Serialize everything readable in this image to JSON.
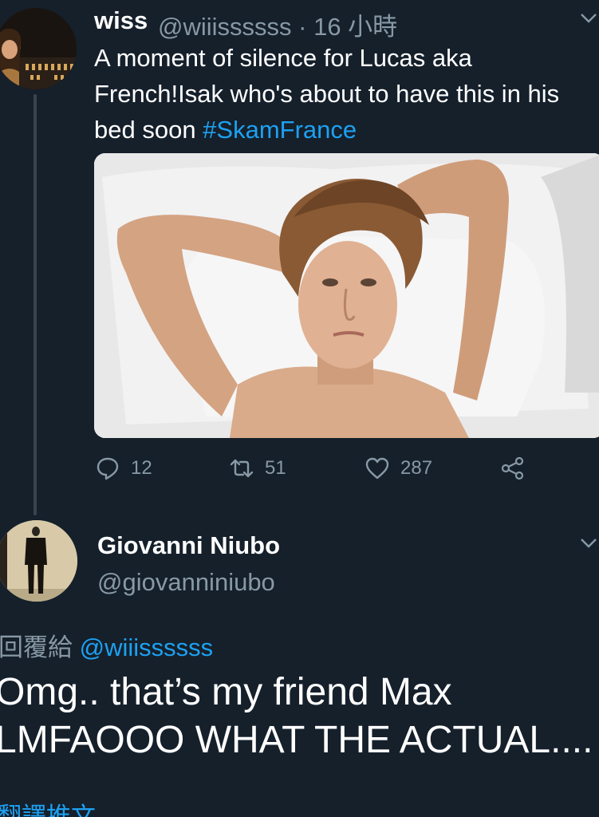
{
  "tweet": {
    "author_name": "wiss",
    "author_handle": "@wiiissssss",
    "timestamp": "· 16 小時",
    "text_before": "A moment of silence for Lucas aka French!Isak who's about to have this in his bed soon ",
    "hashtag": "#SkamFrance",
    "actions": {
      "replies": "12",
      "retweets": "51",
      "likes": "287"
    }
  },
  "reply": {
    "author_name": "Giovanni Niubo",
    "author_handle": "@giovanniniubo",
    "replying_label": "回覆給",
    "replying_to": "@wiiissssss",
    "line1": "Omg.. that’s my friend Max",
    "line2": "LMFAOOO WHAT THE ACTUAL....",
    "translate_label": "翻譯推文"
  },
  "icons": {
    "reply": "reply-icon",
    "retweet": "retweet-icon",
    "like": "heart-icon",
    "share": "share-icon",
    "menu": "chevron-down-icon"
  },
  "colors": {
    "background": "#15202b",
    "accent": "#1da1f2",
    "muted": "#8899a6",
    "thread_line": "#38444d"
  }
}
